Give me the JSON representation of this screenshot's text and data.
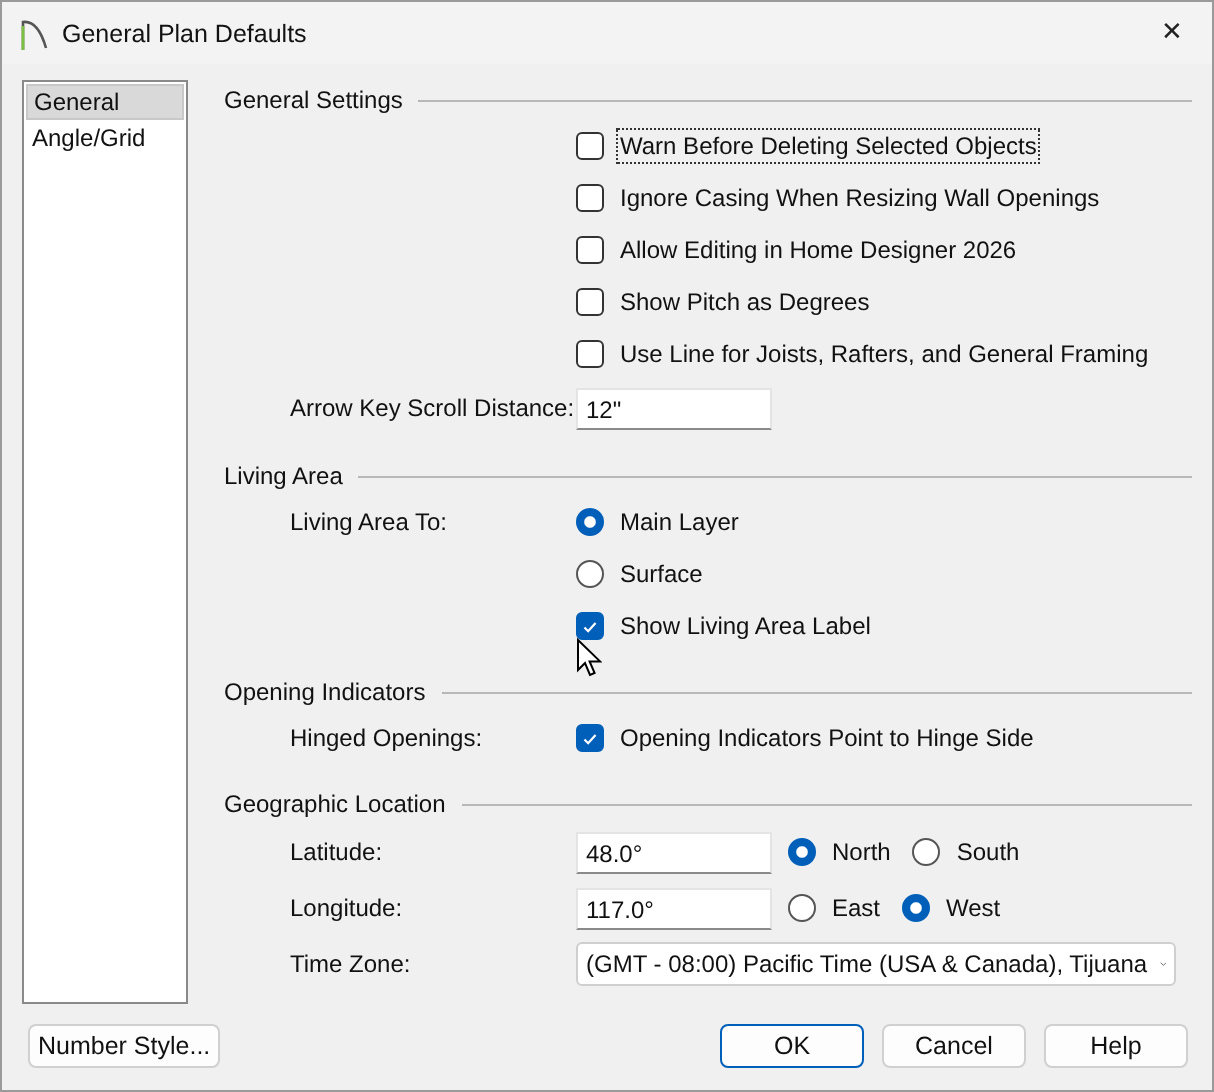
{
  "window": {
    "title": "General Plan Defaults",
    "close": "✕"
  },
  "sidebar": {
    "items": [
      {
        "label": "General",
        "selected": true
      },
      {
        "label": "Angle/Grid",
        "selected": false
      }
    ]
  },
  "sections": [
    {
      "title": "General Settings",
      "rows": [
        {
          "kind": "checkbox",
          "text": "Warn Before Deleting Selected Objects",
          "checked": false,
          "focused": true
        },
        {
          "kind": "checkbox",
          "text": "Ignore Casing When Resizing Wall Openings",
          "checked": false,
          "focused": false
        },
        {
          "kind": "checkbox",
          "text": "Allow Editing in Home Designer 2026",
          "checked": false,
          "focused": false
        },
        {
          "kind": "checkbox",
          "text": "Show Pitch as Degrees",
          "checked": false,
          "focused": false
        },
        {
          "kind": "checkbox",
          "text": "Use Line for Joists, Rafters, and General Framing",
          "checked": false,
          "focused": false
        },
        {
          "kind": "field",
          "label": "Arrow Key Scroll Distance:",
          "value": "12\""
        }
      ]
    },
    {
      "title": "Living Area",
      "rows": [
        {
          "kind": "radio",
          "label": "Living Area To:",
          "text": "Main Layer",
          "selected": true
        },
        {
          "kind": "radio",
          "text": "Surface",
          "selected": false
        },
        {
          "kind": "checkbox",
          "text": "Show Living Area Label",
          "checked": true,
          "focused": false
        }
      ]
    },
    {
      "title": "Opening Indicators",
      "rows": [
        {
          "kind": "checkbox",
          "label": "Hinged Openings:",
          "text": "Opening Indicators Point to Hinge Side",
          "checked": true,
          "focused": false
        }
      ]
    },
    {
      "title": "Geographic Location",
      "rows": [
        {
          "kind": "field-radios",
          "label": "Latitude:",
          "value": "48.0°",
          "options": [
            {
              "label": "North",
              "selected": true
            },
            {
              "label": "South",
              "selected": false
            }
          ]
        },
        {
          "kind": "field-radios",
          "label": "Longitude:",
          "value": "117.0°",
          "options": [
            {
              "label": "East",
              "selected": false
            },
            {
              "label": "West",
              "selected": true
            }
          ]
        },
        {
          "kind": "select",
          "label": "Time Zone:",
          "value": "(GMT - 08:00) Pacific Time (USA & Canada), Tijuana"
        }
      ]
    }
  ],
  "footer": {
    "left_button": "Number Style...",
    "buttons": [
      {
        "label": "OK",
        "default": true
      },
      {
        "label": "Cancel",
        "default": false
      },
      {
        "label": "Help",
        "default": false
      }
    ]
  }
}
